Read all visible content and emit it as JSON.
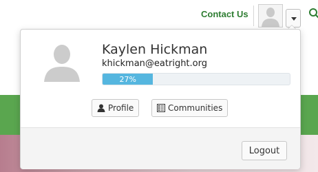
{
  "topbar": {
    "contact_label": "Contact Us",
    "avatar_icon": "user-silhouette-icon",
    "caret_icon": "caret-down-icon",
    "search_icon": "search-icon",
    "link_color": "#2e7d32"
  },
  "profile": {
    "name": "Kaylen Hickman",
    "email": "khickman@eatright.org",
    "progress_text": "27%",
    "progress_value": 0.27,
    "progress_color": "#55b6df"
  },
  "actions": {
    "profile_label": "Profile",
    "profile_icon": "user-icon",
    "communities_label": "Communities",
    "communities_icon": "list-icon",
    "logout_label": "Logout"
  },
  "background": {
    "band_color": "#5aa64f"
  }
}
